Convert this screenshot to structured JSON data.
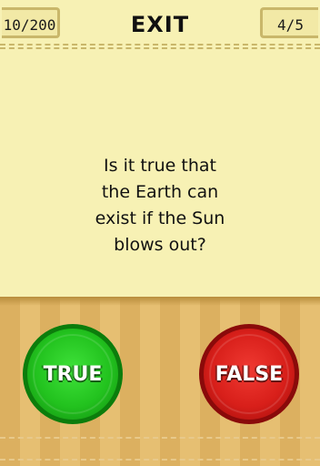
{
  "header": {
    "score": "10/200",
    "exit_label": "EXIT",
    "progress": "4/5"
  },
  "question": {
    "line1": "Is it true that",
    "line2": "the Earth can",
    "line3": "exist if the Sun",
    "line4": "blows out?"
  },
  "answers": {
    "true_label": "TRUE",
    "false_label": "FALSE"
  },
  "colors": {
    "background": "#f7f1b4",
    "wood": "#dcb060",
    "true_button": "#22c21e",
    "false_button": "#d81f1a"
  }
}
